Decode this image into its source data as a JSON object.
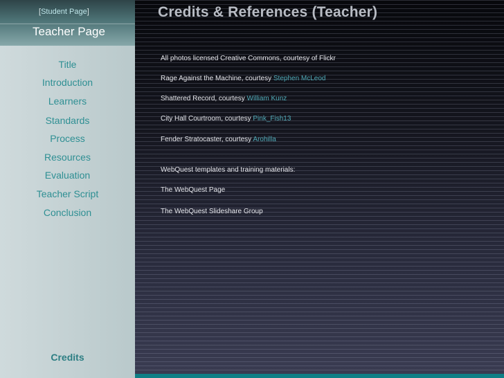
{
  "header": {
    "bracket_open": "[",
    "student_page_link": "Student Page",
    "bracket_close": "]",
    "teacher_page": "Teacher Page"
  },
  "nav": {
    "items": [
      "Title",
      "Introduction",
      "Learners",
      "Standards",
      "Process",
      "Resources",
      "Evaluation",
      "Teacher Script",
      "Conclusion"
    ],
    "credits": "Credits"
  },
  "main": {
    "title": "Credits & References (Teacher)",
    "photos_note": "All photos licensed Creative Commons, courtesy of Flickr",
    "credits": [
      {
        "text": "Rage Against the Machine, courtesy ",
        "link": "Stephen McLeod"
      },
      {
        "text": "Shattered Record, courtesy ",
        "link": "William Kunz"
      },
      {
        "text": "City Hall Courtroom, courtesy ",
        "link": "Pink_Fish13"
      },
      {
        "text": "Fender Stratocaster, courtesy ",
        "link": "Arohilla"
      }
    ],
    "templates_note": "WebQuest templates and training materials:",
    "webquest_page": "The WebQuest Page",
    "webquest_group": "The WebQuest Slideshare Group"
  },
  "colors": {
    "accent_teal": "#2e8f93",
    "link_blue": "#4fa9b6",
    "bottom_band": "#0f7f86"
  }
}
